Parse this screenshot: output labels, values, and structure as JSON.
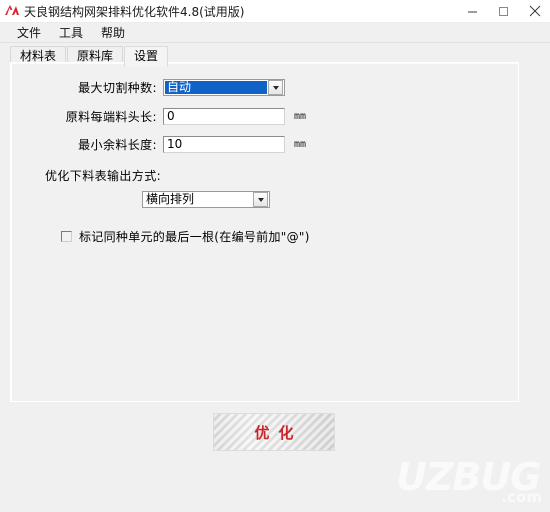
{
  "window": {
    "title": "天良钢结构网架排料优化软件4.8(试用版)",
    "icon": "app-logo-icon",
    "controls": {
      "minimize": "minimize-icon",
      "maximize": "maximize-icon",
      "close": "close-icon"
    }
  },
  "menu": {
    "items": [
      {
        "label": "文件"
      },
      {
        "label": "工具"
      },
      {
        "label": "帮助"
      }
    ]
  },
  "tabs": [
    {
      "label": "材料表",
      "active": false
    },
    {
      "label": "原料库",
      "active": false
    },
    {
      "label": "设置",
      "active": true
    }
  ],
  "settings": {
    "max_cut_kinds": {
      "label": "最大切割种数:",
      "value": "自动"
    },
    "stock_end_waste": {
      "label": "原料每端料头长:",
      "value": "0",
      "unit": "mm"
    },
    "min_remnant_length": {
      "label": "最小余料长度:",
      "value": "10",
      "unit": "mm"
    },
    "output_mode": {
      "label": "优化下料表输出方式:",
      "value": "横向排列"
    },
    "mark_last_unit": {
      "label": "标记同种单元的最后一根(在编号前加\"@\")",
      "checked": false
    }
  },
  "actions": {
    "optimize_label": "优化"
  },
  "watermark": {
    "main": "UZBUG",
    "sub": ".com"
  },
  "colors": {
    "accent_blue": "#1062c6",
    "button_red": "#c8252a",
    "window_bg": "#f0f0f0"
  }
}
